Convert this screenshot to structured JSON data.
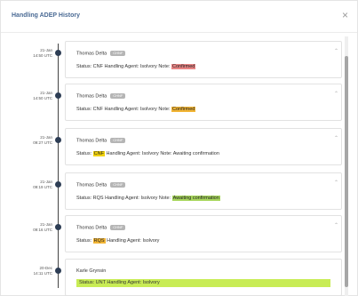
{
  "dialog": {
    "title": "Handling ADEP History",
    "close_symbol": "×"
  },
  "entries": [
    {
      "date": "21-Jan",
      "time": "14:50 UTC",
      "author": "Thomas Delta",
      "tag": "CHNF",
      "line_prefix": "Status: CNF Handling Agent: Isolvory Note: ",
      "note_value": "Confirmed"
    },
    {
      "date": "21-Jan",
      "time": "14:50 UTC",
      "author": "Thomas Delta",
      "tag": "CHNF",
      "line_prefix": "Status: CNF Handling Agent: Isolvory Note: ",
      "note_value": "Confirmed"
    },
    {
      "date": "21-Jan",
      "time": "09:27 UTC",
      "author": "Thomas Delta",
      "tag": "CHNF",
      "status_value": "CNF",
      "line_suffix": " Handling Agent: Isolvory Note: Awaiting confirmation"
    },
    {
      "date": "21-Jan",
      "time": "09:19 UTC",
      "author": "Thomas Delta",
      "tag": "CHNF",
      "line_prefix": "Status: RQS Handling Agent: Isolvory Note: ",
      "note_value": "Awaiting confirmation"
    },
    {
      "date": "21-Jan",
      "time": "09:16 UTC",
      "author": "Thomas Delta",
      "tag": "CHNF",
      "status_value": "RQS",
      "line_suffix": " Handling Agent: Isolvory"
    },
    {
      "date": "20-Dec",
      "time": "14:11 UTC",
      "author": "Karle Grynsin",
      "status_line": "Status: UNT Handling Agent: Isolvory"
    }
  ],
  "labels": {
    "status_prefix": "Status: "
  },
  "colors": {
    "accent": "#4a6a94",
    "timeline_dot": "#2e3e55",
    "red": "#e98585",
    "orange": "#f2b535",
    "yellow": "#f1d20a",
    "green": "#a7d65c",
    "lime": "#c8ec55"
  },
  "icons": {
    "close": "close-icon",
    "expand": "chevron-up-icon"
  }
}
